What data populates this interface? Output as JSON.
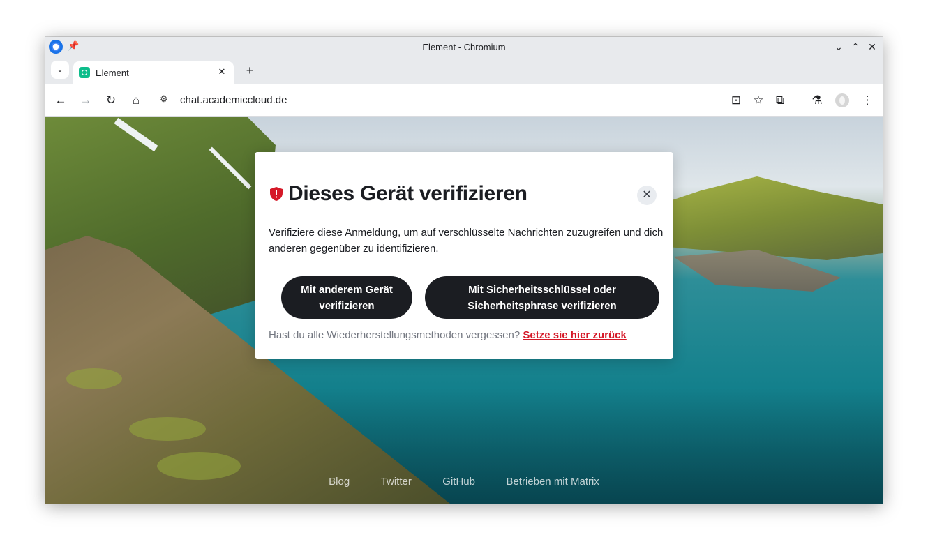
{
  "window": {
    "title": "Element - Chromium",
    "pin_glyph": "📌",
    "controls": {
      "minimize": "⌄",
      "maximize": "⌃",
      "close": "✕"
    }
  },
  "tabs": {
    "search_glyph": "⌄",
    "active": {
      "title": "Element",
      "close": "✕"
    },
    "new_tab": "+"
  },
  "toolbar": {
    "back": "←",
    "forward": "→",
    "reload": "↻",
    "home": "⌂",
    "site_info_glyph": "⚙",
    "url": "chat.academiccloud.de",
    "install": "⊡",
    "bookmark": "☆",
    "extensions": "⧉",
    "labs": "⚗",
    "menu": "⋮"
  },
  "dialog": {
    "title": "Dieses Gerät verifizieren",
    "close": "✕",
    "body": "Verifiziere diese Anmeldung, um auf verschlüsselte Nachrichten zuzugreifen und dich anderen gegenüber zu identifizieren.",
    "btn_device_line1": "Mit anderem Gerät",
    "btn_device_line2": "verifizieren",
    "btn_key_line1": "Mit Sicherheitsschlüssel oder",
    "btn_key_line2": "Sicherheitsphrase verifizieren",
    "forgot_text": "Hast du alle Wiederherstellungsmethoden vergessen?",
    "reset_link": "Setze sie hier zurück",
    "accent_color": "#d51928"
  },
  "footer": {
    "links": [
      "Blog",
      "Twitter",
      "GitHub",
      "Betrieben mit Matrix"
    ]
  }
}
